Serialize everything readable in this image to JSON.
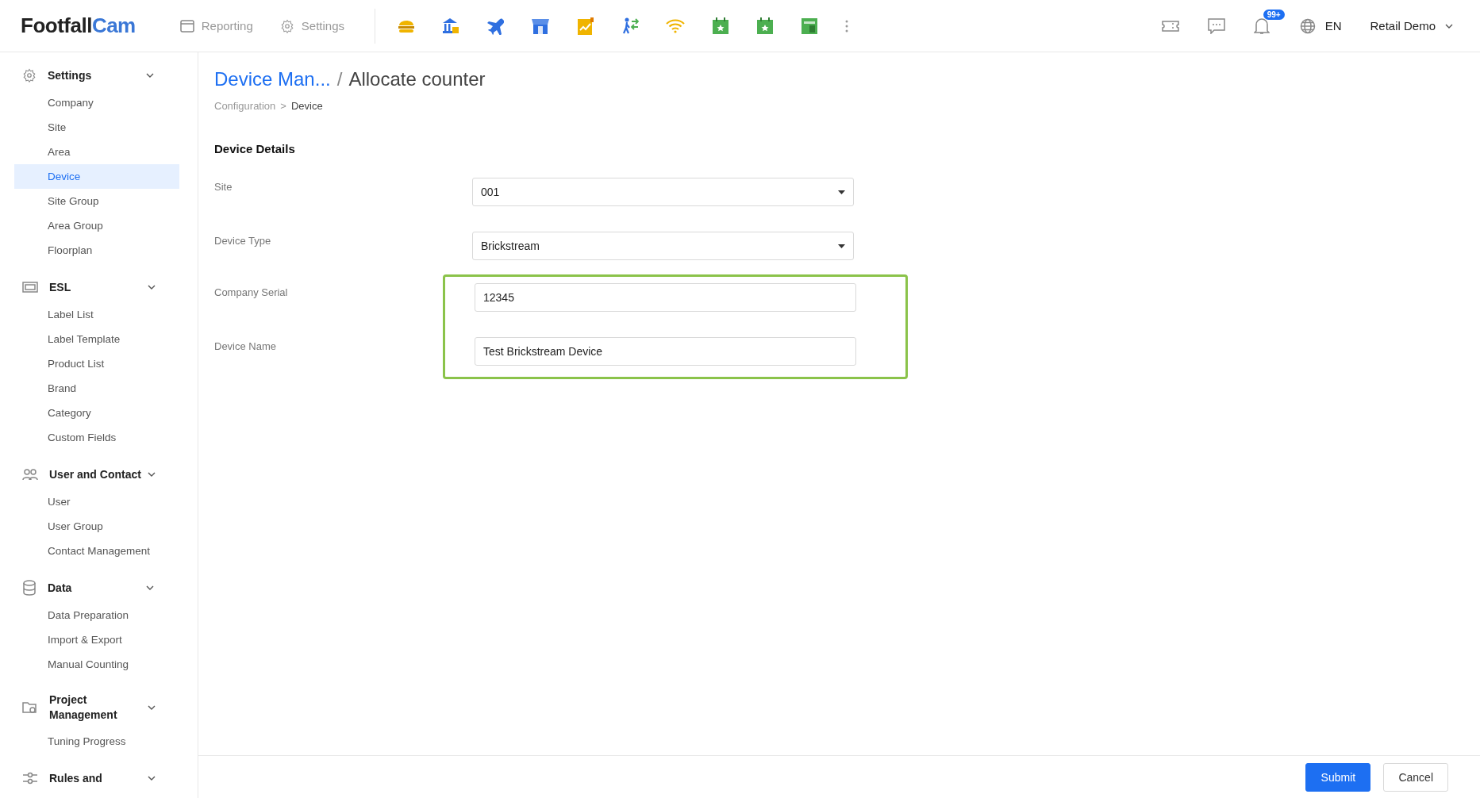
{
  "topbar": {
    "logo": {
      "dark": "Footfall",
      "accent": "Cam"
    },
    "nav": [
      {
        "label": "Reporting",
        "selected": false
      },
      {
        "label": "Settings",
        "selected": false
      }
    ],
    "language": "EN",
    "notification_badge": "99+",
    "user": "Retail Demo"
  },
  "sidebar": {
    "sections": [
      {
        "title": "Settings",
        "expanded": true,
        "items": [
          {
            "label": "Company",
            "selected": false
          },
          {
            "label": "Site",
            "selected": false
          },
          {
            "label": "Area",
            "selected": false
          },
          {
            "label": "Device",
            "selected": true
          },
          {
            "label": "Site Group",
            "selected": false
          },
          {
            "label": "Area Group",
            "selected": false
          },
          {
            "label": "Floorplan",
            "selected": false
          }
        ]
      },
      {
        "title": "ESL",
        "expanded": true,
        "items": [
          {
            "label": "Label List",
            "selected": false
          },
          {
            "label": "Label Template",
            "selected": false
          },
          {
            "label": "Product List",
            "selected": false
          },
          {
            "label": "Brand",
            "selected": false
          },
          {
            "label": "Category",
            "selected": false
          },
          {
            "label": "Custom Fields",
            "selected": false
          }
        ]
      },
      {
        "title": "User and Contact",
        "expanded": true,
        "items": [
          {
            "label": "User",
            "selected": false
          },
          {
            "label": "User Group",
            "selected": false
          },
          {
            "label": "Contact Management",
            "selected": false
          }
        ]
      },
      {
        "title": "Data",
        "expanded": true,
        "items": [
          {
            "label": "Data Preparation",
            "selected": false
          },
          {
            "label": "Import & Export",
            "selected": false
          },
          {
            "label": "Manual Counting",
            "selected": false
          }
        ]
      },
      {
        "title": "Project Management",
        "expanded": true,
        "items": [
          {
            "label": "Tuning Progress",
            "selected": false
          }
        ]
      },
      {
        "title": "Rules and",
        "expanded": true
      }
    ]
  },
  "page": {
    "title_link": "Device Man...",
    "separator": "/",
    "title": "Allocate counter",
    "breadcrumb": [
      {
        "label": "Configuration",
        "selected": false
      },
      {
        "label": ">",
        "selected": false
      },
      {
        "label": "Device",
        "selected": true
      }
    ],
    "section_title": "Device Details",
    "fields": [
      {
        "label": "Site",
        "kind": "select",
        "value": "001",
        "highlighted": false
      },
      {
        "label": "Device Type",
        "kind": "select",
        "value": "Brickstream",
        "highlighted": false
      },
      {
        "label": "Company Serial",
        "kind": "input",
        "value": "12345",
        "highlighted": true
      },
      {
        "label": "Device Name",
        "kind": "input",
        "value": "Test Brickstream Device",
        "highlighted": true
      }
    ]
  },
  "footer": {
    "buttons": [
      {
        "label": "Submit",
        "kind": "primary"
      },
      {
        "label": "Cancel",
        "kind": "default"
      }
    ]
  }
}
